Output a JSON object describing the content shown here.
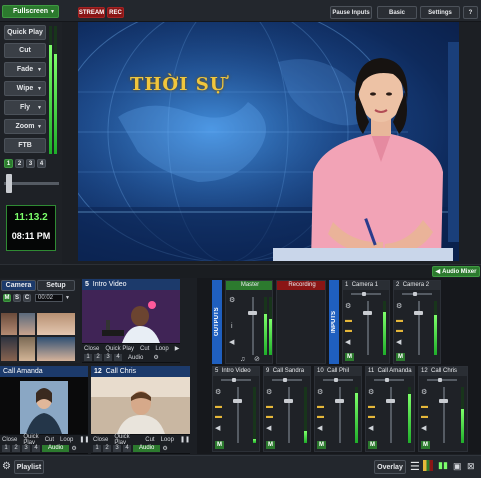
{
  "topbar": {
    "fullscreen": "Fullscreen",
    "stream": "STREAM",
    "rec": "REC",
    "pause_inputs": "Pause Inputs",
    "basic": "Basic",
    "settings": "Settings",
    "help": "?"
  },
  "transitions": {
    "quick_play": "Quick Play",
    "cut": "Cut",
    "fade": "Fade",
    "wipe": "Wipe",
    "fly": "Fly",
    "zoom": "Zoom",
    "ftb": "FTB",
    "pages": [
      "1",
      "2",
      "3",
      "4"
    ]
  },
  "clock": {
    "countdown": "11:13.2",
    "time": "08:11 PM"
  },
  "preview": {
    "overlay_title": "THỜI SỰ"
  },
  "audio_mixer_label": "Audio Mixer",
  "camera_panel": {
    "tab_camera": "Camera",
    "tab_setup": "Setup",
    "m": "M",
    "s": "S",
    "c": "C",
    "time": "00:02"
  },
  "inputs": [
    {
      "num": "5",
      "name": "Intro Video"
    },
    {
      "num": "",
      "name": "Call Amanda"
    },
    {
      "num": "12",
      "name": "Call Chris"
    }
  ],
  "tile_controls": {
    "close": "Close",
    "quick_play": "Quick Play",
    "cut": "Cut",
    "loop": "Loop",
    "audio": "Audio",
    "nums": [
      "1",
      "2",
      "3",
      "4"
    ]
  },
  "mixer": {
    "outputs_label": "OUTPUTS",
    "inputs_label": "INPUTS",
    "master": "Master",
    "recording": "Recording",
    "top_strips": [
      {
        "num": "1",
        "name": "Camera 1"
      },
      {
        "num": "2",
        "name": "Camera 2"
      }
    ],
    "bottom_strips": [
      {
        "num": "5",
        "name": "Intro Video"
      },
      {
        "num": "9",
        "name": "Call Sandra"
      },
      {
        "num": "10",
        "name": "Call Phil"
      },
      {
        "num": "11",
        "name": "Call Amanda"
      },
      {
        "num": "12",
        "name": "Call Chris"
      }
    ],
    "m_label": "M"
  },
  "bottombar": {
    "playlist": "Playlist",
    "overlay": "Overlay"
  },
  "colors": {
    "accent_green": "#2c7a2e",
    "stream_red": "#8a1515",
    "tile_blue": "#1c3a6b"
  }
}
